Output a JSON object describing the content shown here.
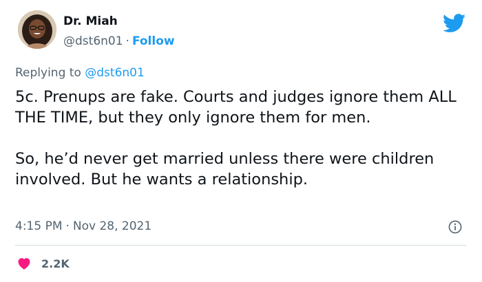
{
  "author": {
    "name": "Dr. Miah",
    "handle": "@dst6n01",
    "separator": "·",
    "follow_label": "Follow"
  },
  "reply": {
    "prefix": "Replying to",
    "mention": "@dst6n01"
  },
  "tweet": {
    "paragraphs": [
      "5c. Prenups are fake. Courts and judges ignore them ALL THE TIME, but they only ignore them for men.",
      "So, he’d never get married unless there were children involved. But he wants a relationship."
    ]
  },
  "meta": {
    "time": "4:15 PM",
    "separator": "·",
    "date": "Nov 28, 2021"
  },
  "engagement": {
    "likes": "2.2K"
  },
  "icons": {
    "brand": "twitter-bird-icon",
    "info": "info-icon",
    "like": "heart-icon"
  },
  "colors": {
    "brand_blue": "#1d9bf0",
    "like_red": "#f91880",
    "muted": "#536471",
    "text": "#0f1419"
  }
}
